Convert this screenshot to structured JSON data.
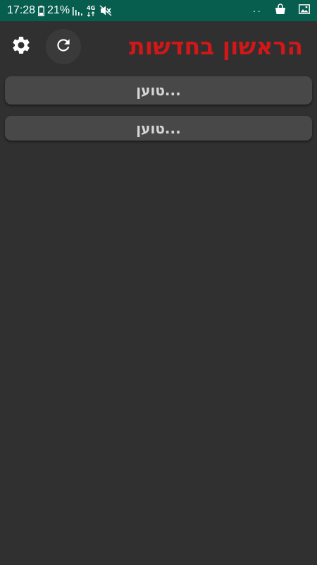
{
  "status_bar": {
    "time": "17:28",
    "battery": "21%",
    "network": "4G",
    "icons": [
      "battery-icon",
      "signal-icon",
      "network-4g-icon",
      "mute-icon",
      "more-dots-icon",
      "shopping-bag-icon",
      "gallery-icon"
    ]
  },
  "header": {
    "title": "הראשון בחדשות",
    "title_color": "#d11717",
    "settings_icon": "gear-icon",
    "refresh_icon": "refresh-icon"
  },
  "feeds": [
    {
      "label": "טוען..."
    },
    {
      "label": "טוען..."
    }
  ],
  "colors": {
    "status_bar": "#075e4f",
    "background": "#303030",
    "row": "#484848",
    "row_text": "#d6d6d6"
  }
}
